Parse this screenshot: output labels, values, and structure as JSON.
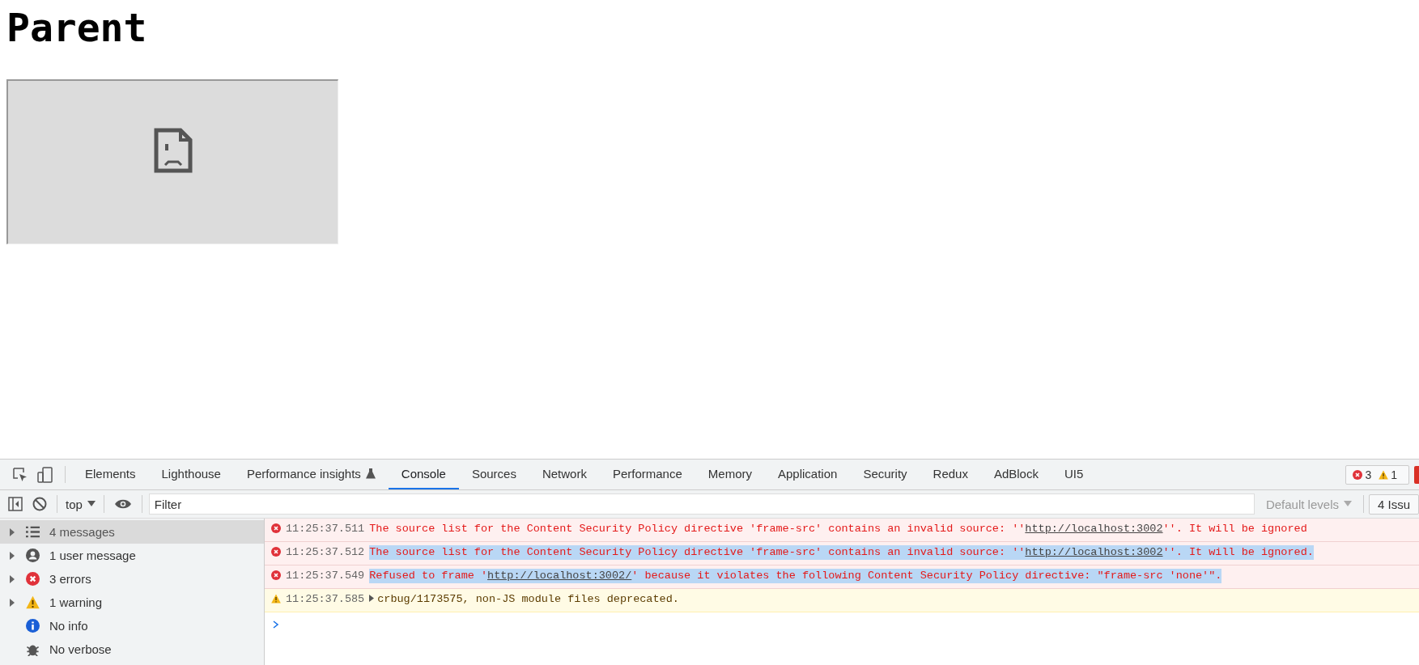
{
  "page": {
    "heading": "Parent"
  },
  "devtools": {
    "tabs": [
      {
        "label": "Elements",
        "selected": false,
        "experimental": false
      },
      {
        "label": "Lighthouse",
        "selected": false,
        "experimental": false
      },
      {
        "label": "Performance insights",
        "selected": false,
        "experimental": true
      },
      {
        "label": "Console",
        "selected": true,
        "experimental": false
      },
      {
        "label": "Sources",
        "selected": false,
        "experimental": false
      },
      {
        "label": "Network",
        "selected": false,
        "experimental": false
      },
      {
        "label": "Performance",
        "selected": false,
        "experimental": false
      },
      {
        "label": "Memory",
        "selected": false,
        "experimental": false
      },
      {
        "label": "Application",
        "selected": false,
        "experimental": false
      },
      {
        "label": "Security",
        "selected": false,
        "experimental": false
      },
      {
        "label": "Redux",
        "selected": false,
        "experimental": false
      },
      {
        "label": "AdBlock",
        "selected": false,
        "experimental": false
      },
      {
        "label": "UI5",
        "selected": false,
        "experimental": false
      }
    ],
    "counters": [
      {
        "kind": "error",
        "count": "3"
      },
      {
        "kind": "warning",
        "count": "1"
      }
    ],
    "toolbar": {
      "context": "top",
      "filter_placeholder": "Filter",
      "levels": "Default levels",
      "issues": "4 Issu"
    },
    "sidebar": [
      {
        "kind": "messages",
        "label": "4 messages",
        "selected": true,
        "expandable": true
      },
      {
        "kind": "user",
        "label": "1 user message",
        "selected": false,
        "expandable": true
      },
      {
        "kind": "error",
        "label": "3 errors",
        "selected": false,
        "expandable": true
      },
      {
        "kind": "warning",
        "label": "1 warning",
        "selected": false,
        "expandable": true
      },
      {
        "kind": "info",
        "label": "No info",
        "selected": false,
        "expandable": false
      },
      {
        "kind": "verbose",
        "label": "No verbose",
        "selected": false,
        "expandable": false
      }
    ],
    "messages": [
      {
        "kind": "error",
        "time": "11:25:37.511",
        "highlighted": false,
        "expandable": false,
        "parts": [
          {
            "kind": "text",
            "text": "The source list for the Content Security Policy directive 'frame-src' contains an invalid source: ''"
          },
          {
            "kind": "link",
            "text": "http://localhost:3002"
          },
          {
            "kind": "text",
            "text": "''. It will be ignored"
          }
        ]
      },
      {
        "kind": "error",
        "time": "11:25:37.512",
        "highlighted": true,
        "expandable": false,
        "parts": [
          {
            "kind": "text",
            "text": "The source list for the Content Security Policy directive 'frame-src' contains an invalid source: ''"
          },
          {
            "kind": "link",
            "text": "http://localhost:3002"
          },
          {
            "kind": "text",
            "text": "''. It will be ignored."
          }
        ]
      },
      {
        "kind": "error",
        "time": "11:25:37.549",
        "highlighted": true,
        "expandable": false,
        "parts": [
          {
            "kind": "text",
            "text": "Refused to frame '"
          },
          {
            "kind": "link",
            "text": "http://localhost:3002/"
          },
          {
            "kind": "text",
            "text": "' because it violates the following Content Security Policy directive: \"frame-src 'none'\"."
          }
        ]
      },
      {
        "kind": "warning",
        "time": "11:25:37.585",
        "highlighted": false,
        "expandable": true,
        "parts": [
          {
            "kind": "text",
            "text": "crbug/1173575, non-JS module files deprecated."
          }
        ]
      }
    ]
  }
}
